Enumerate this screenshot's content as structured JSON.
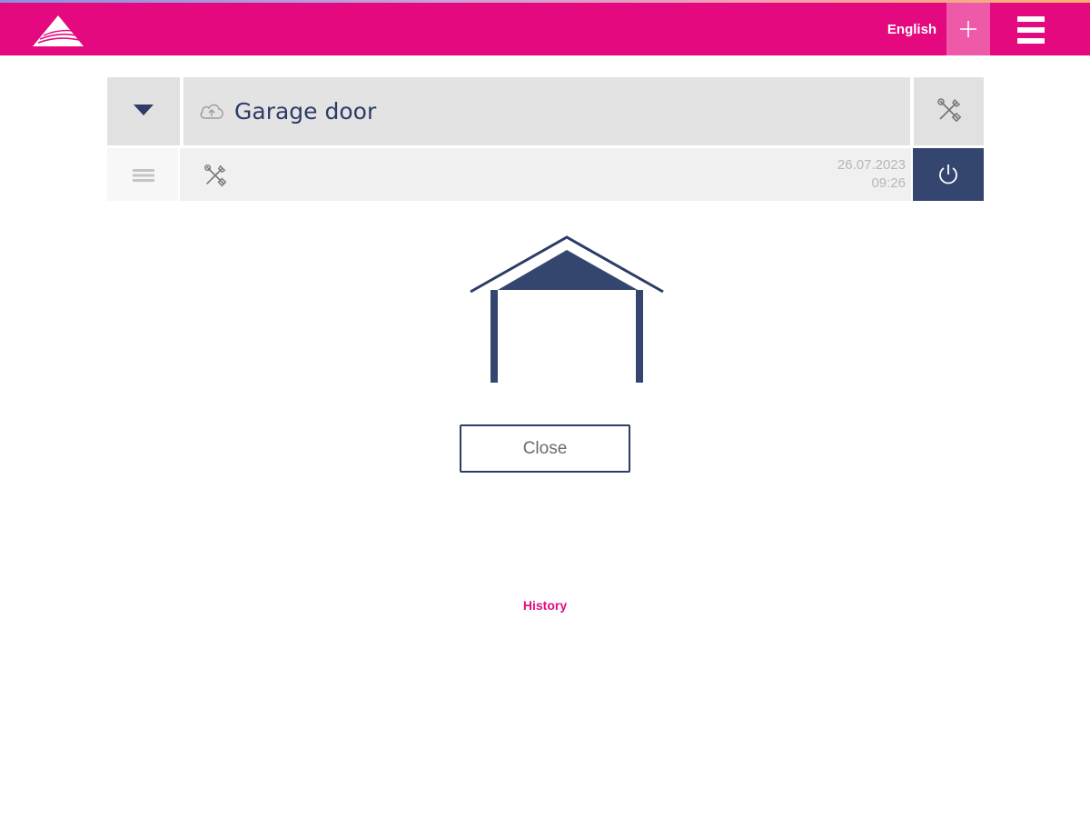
{
  "header": {
    "language": "English",
    "colors": {
      "accent": "#e5097f",
      "accent_light": "#ee5aa8"
    },
    "icons": {
      "logo": "brand-triangle-logo",
      "add": "plus-icon",
      "menu": "hamburger-icon"
    }
  },
  "device": {
    "name": "Garage door",
    "date": "26.07.2023",
    "time": "09:26",
    "icons": {
      "expand": "chevron-down-icon",
      "cloud": "cloud-upload-icon",
      "settings": "tools-icon",
      "handle": "drag-handle-icon",
      "status": "tools-icon",
      "power": "power-icon"
    },
    "colors": {
      "primary": "#34466f",
      "text": "#2d3b67"
    }
  },
  "main": {
    "state_icon": "garage-open-icon",
    "action_label": "Close",
    "history_label": "History"
  }
}
